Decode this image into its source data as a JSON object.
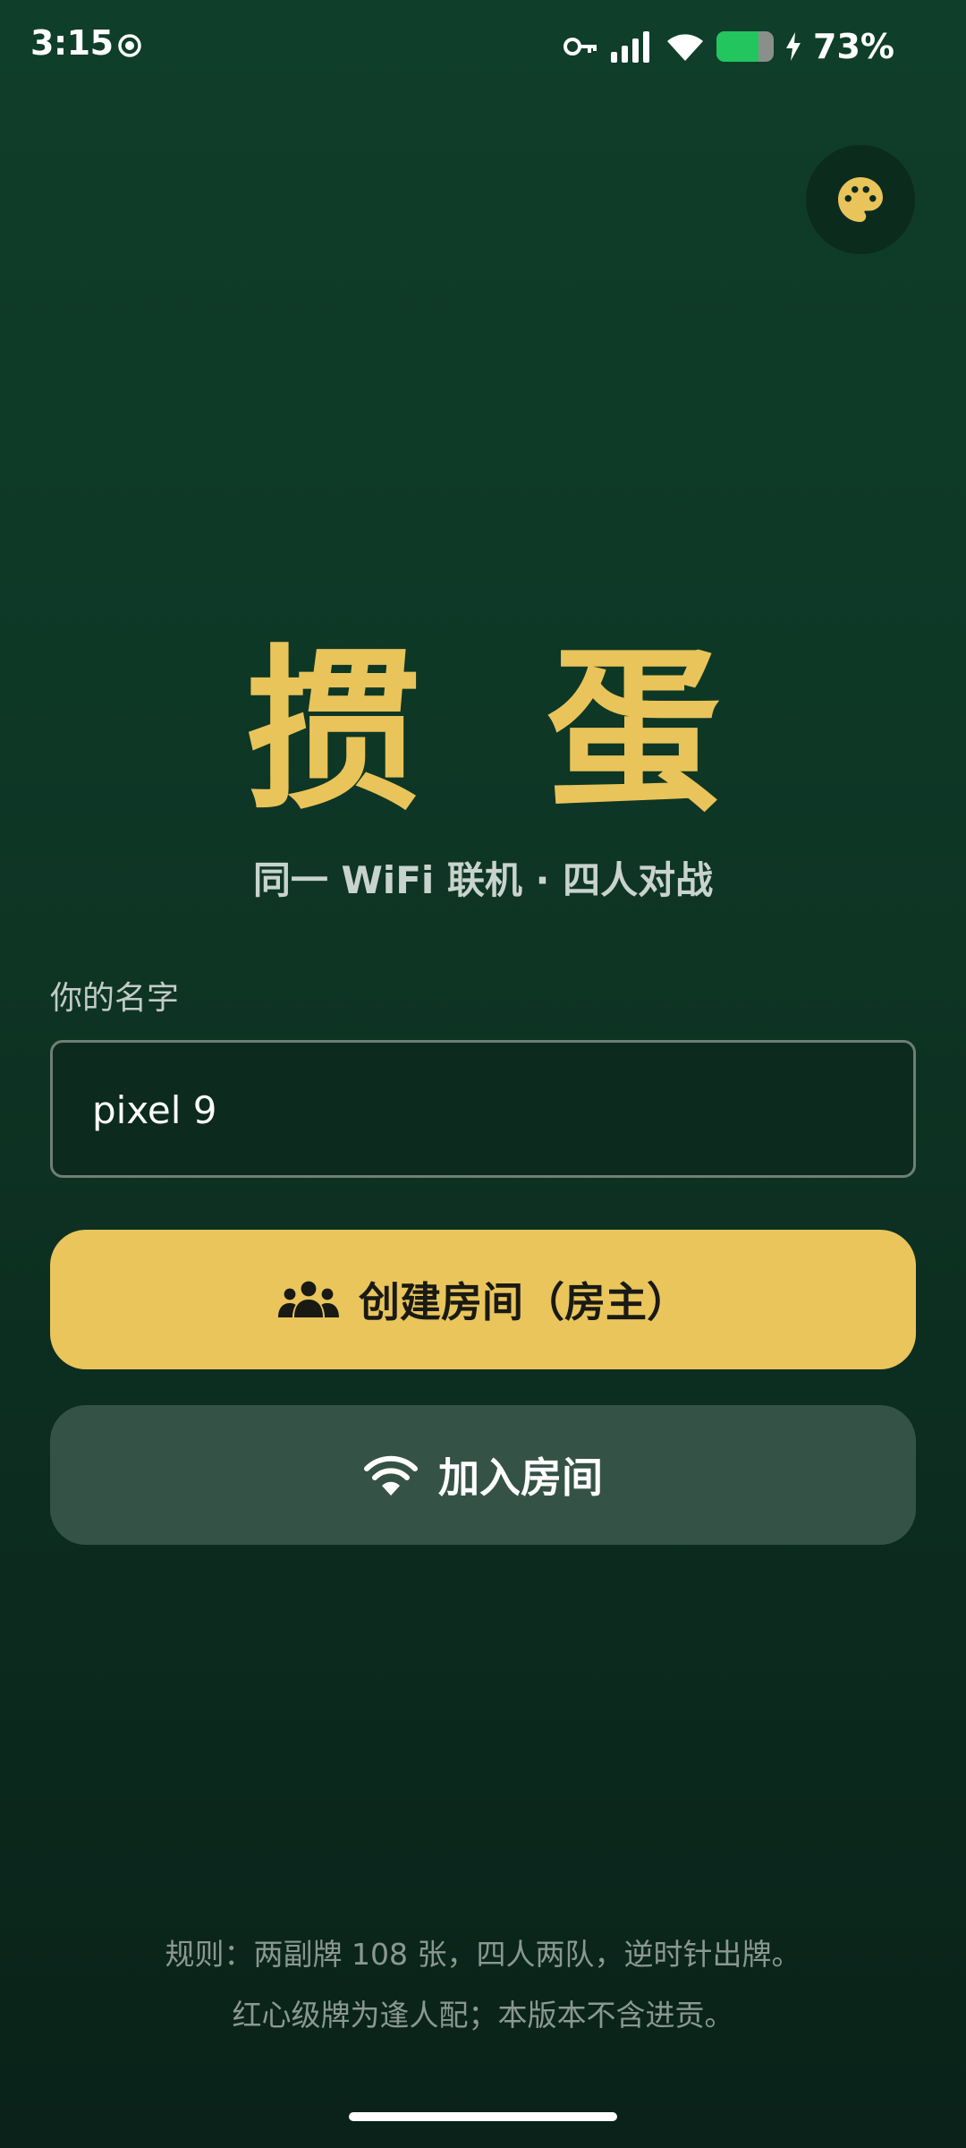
{
  "status_bar": {
    "time": "3:15",
    "battery_percent_label": "73%",
    "battery_level": 0.73,
    "icons": [
      "record-icon",
      "vpn-key-icon",
      "signal-icon",
      "wifi-icon",
      "battery-icon",
      "charging-bolt-icon"
    ]
  },
  "palette_button": {
    "icon": "palette-icon"
  },
  "header": {
    "title": "掼 蛋",
    "subtitle": "同一 WiFi 联机 · 四人对战"
  },
  "name_field": {
    "label": "你的名字",
    "value": "pixel 9"
  },
  "actions": {
    "create_room": {
      "label": "创建房间（房主）",
      "icon": "group-icon"
    },
    "join_room": {
      "label": "加入房间",
      "icon": "wifi-icon"
    }
  },
  "footer": {
    "rules_line_1": "规则：两副牌 108 张，四人两队，逆时针出牌。",
    "rules_line_2": "红心级牌为逢人配；本版本不含进贡。"
  },
  "colors": {
    "accent": "#e9c55c",
    "background_top": "#0f3e2a",
    "background_bottom": "#0a2219",
    "secondary_button": "#355246",
    "battery_fill": "#22c55e"
  }
}
